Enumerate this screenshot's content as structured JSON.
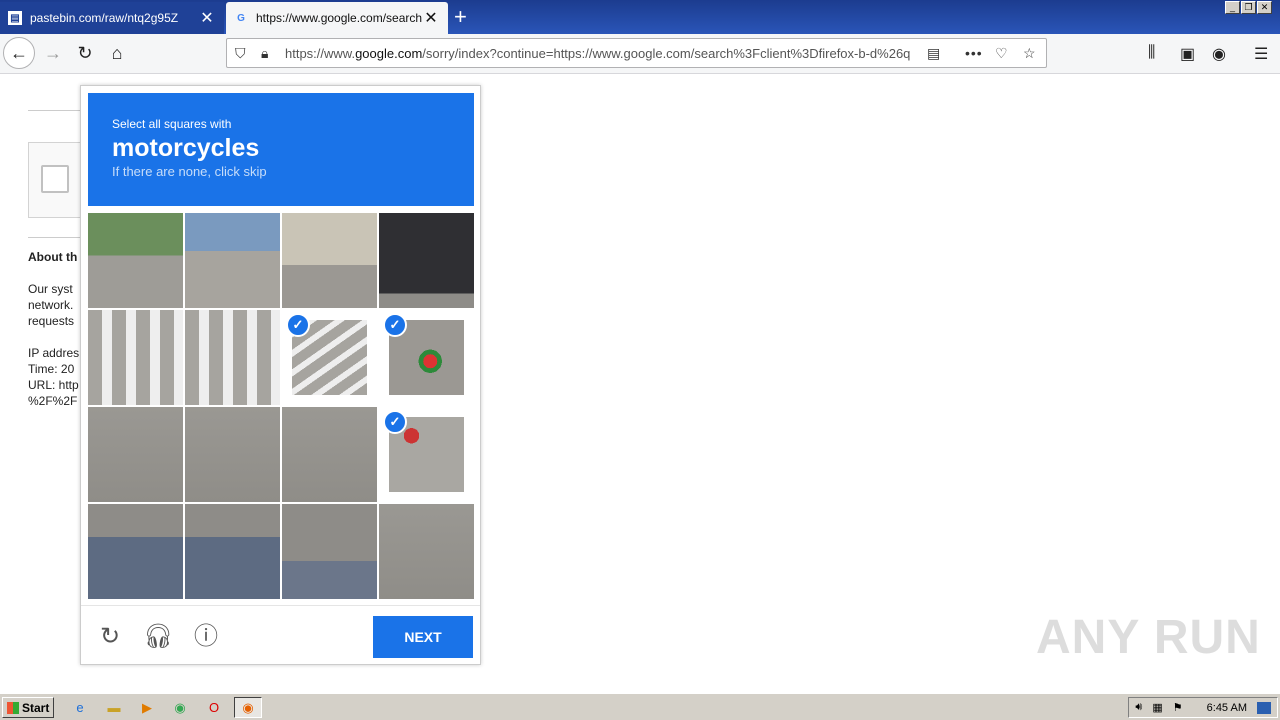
{
  "tabs": [
    {
      "title": "pastebin.com/raw/ntq2g95Z",
      "favicon": "pastebin-icon"
    },
    {
      "title": "https://www.google.com/search?c",
      "favicon": "google-icon"
    }
  ],
  "urlbar": {
    "url_prefix": "https://www.",
    "url_domain": "google.com",
    "url_rest": "/sorry/index?continue=https://www.google.com/search%3Fclient%3Dfirefox-b-d%26q"
  },
  "page": {
    "about_heading": "About th",
    "para_lines": [
      "Our syst",
      "network.",
      "requests"
    ],
    "info_lines": [
      "IP addres",
      "Time: 20",
      "URL: http",
      "%2F%2F"
    ]
  },
  "captcha": {
    "instruction": "Select all squares with",
    "target": "motorcycles",
    "subtext": "If there are none, click skip",
    "selected_tiles": [
      6,
      7,
      11
    ],
    "next_label": "NEXT",
    "colors": {
      "accent": "#1a73e8"
    }
  },
  "watermark": "ANY RUN",
  "taskbar": {
    "start_label": "Start",
    "clock": "6:45 AM"
  }
}
